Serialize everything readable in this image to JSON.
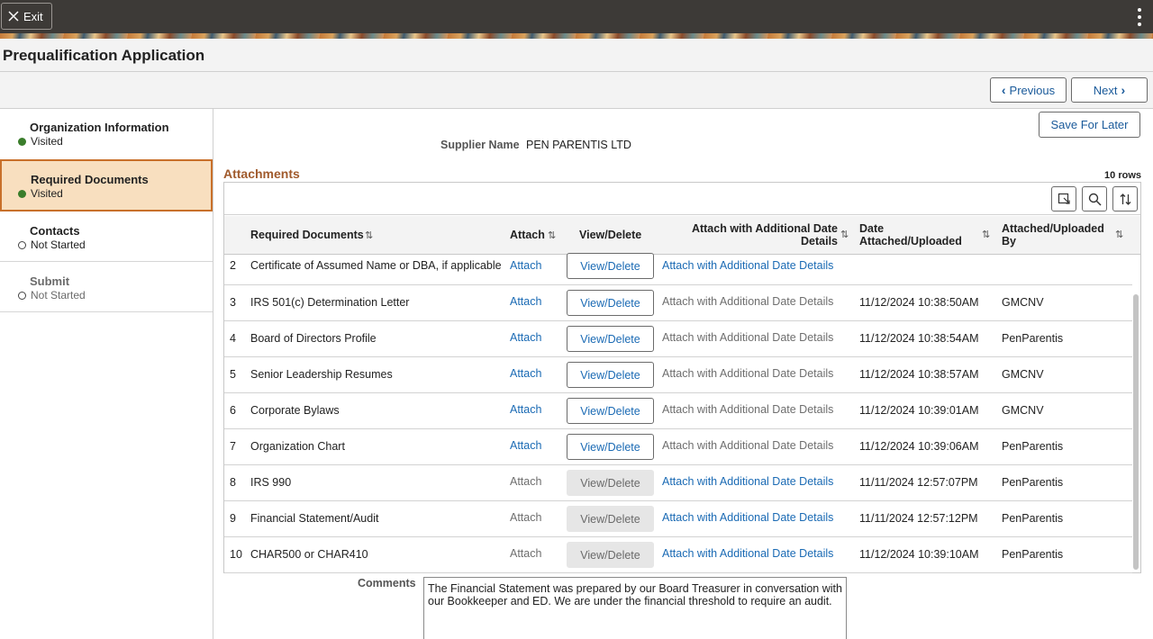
{
  "header": {
    "exit_label": "Exit"
  },
  "page": {
    "title": "Prequalification Application"
  },
  "nav": {
    "previous_label": "Previous",
    "next_label": "Next"
  },
  "sidebar": {
    "steps": [
      {
        "title": "Organization Information",
        "status": "Visited"
      },
      {
        "title": "Required Documents",
        "status": "Visited"
      },
      {
        "title": "Contacts",
        "status": "Not Started"
      },
      {
        "title": "Submit",
        "status": "Not Started"
      }
    ]
  },
  "main": {
    "save_label": "Save For Later",
    "supplier_label": "Supplier Name",
    "supplier_value": "PEN PARENTIS LTD",
    "attachments_title": "Attachments",
    "rows_count": "10 rows"
  },
  "table": {
    "columns": {
      "required_documents": "Required Documents",
      "attach": "Attach",
      "view_delete": "View/Delete",
      "attach_additional": "Attach with Additional Date Details",
      "date_attached": "Date Attached/Uploaded",
      "attached_by": "Attached/Uploaded By"
    },
    "rows": [
      {
        "num": "2",
        "doc": "Certificate of Assumed Name or DBA, if applicable",
        "attach": "Attach",
        "view": "View/Delete",
        "additional": "Attach with Additional Date Details",
        "date": "",
        "by": ""
      },
      {
        "num": "3",
        "doc": "IRS 501(c) Determination Letter",
        "attach": "Attach",
        "view": "View/Delete",
        "additional": "Attach with Additional Date Details",
        "date": "11/12/2024 10:38:50AM",
        "by": "GMCNV"
      },
      {
        "num": "4",
        "doc": "Board of Directors Profile",
        "attach": "Attach",
        "view": "View/Delete",
        "additional": "Attach with Additional Date Details",
        "date": "11/12/2024 10:38:54AM",
        "by": "PenParentis"
      },
      {
        "num": "5",
        "doc": "Senior Leadership Resumes",
        "attach": "Attach",
        "view": "View/Delete",
        "additional": "Attach with Additional Date Details",
        "date": "11/12/2024 10:38:57AM",
        "by": "GMCNV"
      },
      {
        "num": "6",
        "doc": "Corporate Bylaws",
        "attach": "Attach",
        "view": "View/Delete",
        "additional": "Attach with Additional Date Details",
        "date": "11/12/2024 10:39:01AM",
        "by": "GMCNV"
      },
      {
        "num": "7",
        "doc": "Organization Chart",
        "attach": "Attach",
        "view": "View/Delete",
        "additional": "Attach with Additional Date Details",
        "date": "11/12/2024 10:39:06AM",
        "by": "PenParentis"
      },
      {
        "num": "8",
        "doc": "IRS 990",
        "attach": "Attach",
        "view": "View/Delete",
        "additional": "Attach with Additional Date Details",
        "date": "11/11/2024 12:57:07PM",
        "by": "PenParentis"
      },
      {
        "num": "9",
        "doc": "Financial Statement/Audit",
        "attach": "Attach",
        "view": "View/Delete",
        "additional": "Attach with Additional Date Details",
        "date": "11/11/2024 12:57:12PM",
        "by": "PenParentis"
      },
      {
        "num": "10",
        "doc": "CHAR500 or CHAR410",
        "attach": "Attach",
        "view": "View/Delete",
        "additional": "Attach with Additional Date Details",
        "date": "11/12/2024 10:39:10AM",
        "by": "PenParentis"
      }
    ]
  },
  "comments": {
    "label": "Comments",
    "value": "The Financial Statement was prepared by our Board Treasurer in conversation with our Bookkeeper and ED. We are under the financial threshold to require an audit."
  },
  "colors": {
    "accent": "#a05a2c",
    "active_step_bg": "#f8dfbf",
    "active_step_border": "#c8702a",
    "link": "#1a6ab4",
    "visited_dot": "#3a7d2b"
  }
}
